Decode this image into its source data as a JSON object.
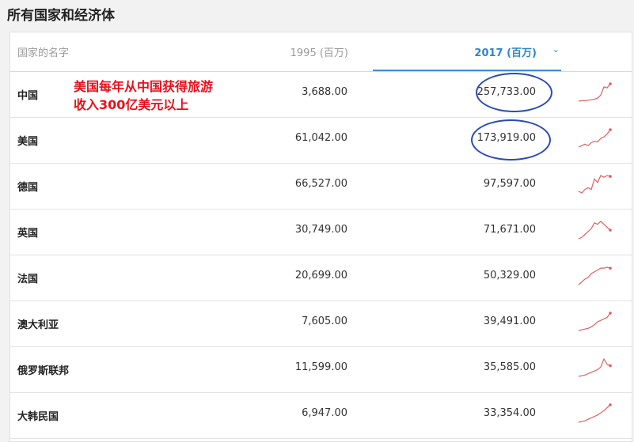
{
  "page": {
    "title": "所有国家和经济体"
  },
  "table": {
    "columns": {
      "name": "国家的名字",
      "y1995": "1995 (百万)",
      "y2017": "2017 (百万)"
    },
    "rows": [
      {
        "name": "中国",
        "v1995": "3,688.00",
        "v2017": "257,733.00",
        "trend": [
          2,
          3,
          3,
          4,
          5,
          6,
          8,
          14,
          30,
          28,
          36
        ]
      },
      {
        "name": "美国",
        "v1995": "61,042.00",
        "v2017": "173,919.00",
        "trend": [
          4,
          6,
          8,
          6,
          10,
          12,
          11,
          16,
          18,
          22,
          28
        ]
      },
      {
        "name": "德国",
        "v1995": "66,527.00",
        "v2017": "97,597.00",
        "trend": [
          8,
          6,
          10,
          12,
          10,
          22,
          18,
          26,
          24,
          26,
          25
        ]
      },
      {
        "name": "英国",
        "v1995": "30,749.00",
        "v2017": "71,671.00",
        "trend": [
          6,
          8,
          12,
          16,
          20,
          28,
          26,
          30,
          26,
          22,
          18
        ]
      },
      {
        "name": "法国",
        "v1995": "20,699.00",
        "v2017": "50,329.00",
        "trend": [
          6,
          9,
          12,
          14,
          18,
          20,
          22,
          24,
          24,
          25,
          24
        ]
      },
      {
        "name": "澳大利亚",
        "v1995": "7,605.00",
        "v2017": "39,491.00",
        "trend": [
          4,
          5,
          6,
          7,
          9,
          12,
          16,
          18,
          20,
          22,
          28
        ]
      },
      {
        "name": "俄罗斯联邦",
        "v1995": "11,599.00",
        "v2017": "35,585.00",
        "trend": [
          4,
          5,
          6,
          8,
          10,
          12,
          14,
          18,
          30,
          22,
          20
        ]
      },
      {
        "name": "大韩民国",
        "v1995": "6,947.00",
        "v2017": "33,354.00",
        "trend": [
          4,
          5,
          6,
          8,
          10,
          12,
          14,
          17,
          20,
          24,
          28
        ]
      }
    ]
  },
  "annotation": {
    "line1": "美国每年从中国获得旅游",
    "line2": "收入300亿美元以上"
  },
  "colors": {
    "sort_accent": "#2f86c9",
    "sparkline": "#e06060",
    "annotation_text": "#e8101a",
    "circle": "#2b4bb8"
  },
  "icons": {
    "sort": "chevron-down-icon"
  }
}
